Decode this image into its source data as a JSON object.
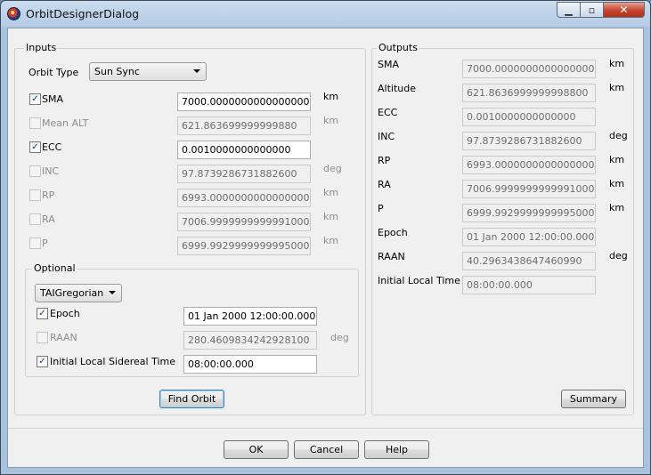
{
  "window": {
    "title": "OrbitDesignerDialog"
  },
  "inputs": {
    "group_label": "Inputs",
    "orbit_type_label": "Orbit Type",
    "orbit_type_value": "Sun Sync",
    "rows": [
      {
        "label": "SMA",
        "checked": true,
        "enabled": true,
        "value": "7000.0000000000000000",
        "unit": "km"
      },
      {
        "label": "Mean ALT",
        "checked": false,
        "enabled": false,
        "value": "621.863699999999880",
        "unit": "km"
      },
      {
        "label": "ECC",
        "checked": true,
        "enabled": true,
        "value": "0.0010000000000000",
        "unit": ""
      },
      {
        "label": "INC",
        "checked": false,
        "enabled": false,
        "value": "97.8739286731882600",
        "unit": "deg"
      },
      {
        "label": "RP",
        "checked": false,
        "enabled": false,
        "value": "6993.0000000000000000",
        "unit": "km"
      },
      {
        "label": "RA",
        "checked": false,
        "enabled": false,
        "value": "7006.9999999999991000",
        "unit": "km"
      },
      {
        "label": "P",
        "checked": false,
        "enabled": false,
        "value": "6999.9929999999995000",
        "unit": "km"
      }
    ],
    "optional": {
      "group_label": "Optional",
      "time_format": "TAIGregorian",
      "epoch_label": "Epoch",
      "epoch_value": "01 Jan 2000 12:00:00.000",
      "raan_label": "RAAN",
      "raan_value": "280.4609834242928100",
      "raan_unit": "deg",
      "ilst_label": "Initial Local Sidereal Time",
      "ilst_value": "08:00:00.000"
    },
    "find_orbit_label": "Find Orbit"
  },
  "outputs": {
    "group_label": "Outputs",
    "rows": [
      {
        "label": "SMA",
        "value": "7000.0000000000000000",
        "unit": "km"
      },
      {
        "label": "Altitude",
        "value": "621.8636999999998800",
        "unit": "km"
      },
      {
        "label": "ECC",
        "value": "0.0010000000000000",
        "unit": ""
      },
      {
        "label": "INC",
        "value": "97.8739286731882600",
        "unit": "deg"
      },
      {
        "label": "RP",
        "value": "6993.0000000000000000",
        "unit": "km"
      },
      {
        "label": "RA",
        "value": "7006.9999999999991000",
        "unit": "km"
      },
      {
        "label": "P",
        "value": "6999.9929999999995000",
        "unit": "km"
      },
      {
        "label": "Epoch",
        "value": "01 Jan 2000 12:00:00.000",
        "unit": ""
      },
      {
        "label": "RAAN",
        "value": "40.2963438647460990",
        "unit": "deg"
      },
      {
        "label": "Initial Local Time",
        "value": "08:00:00.000",
        "unit": ""
      }
    ],
    "summary_label": "Summary"
  },
  "footer": {
    "ok_label": "OK",
    "cancel_label": "Cancel",
    "help_label": "Help"
  }
}
